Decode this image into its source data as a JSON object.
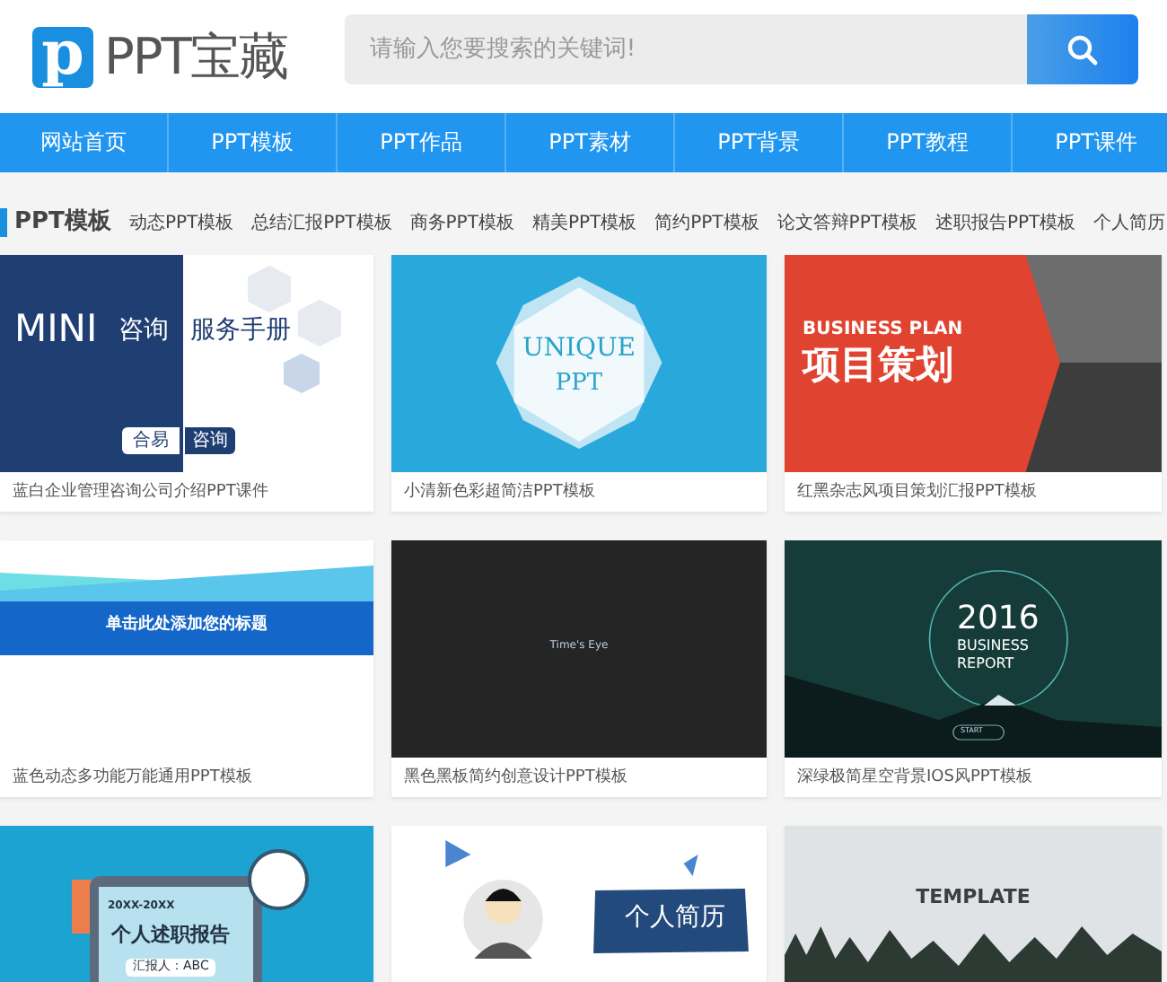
{
  "header": {
    "logo_letter": "p",
    "logo_text": "PPT宝藏",
    "search": {
      "placeholder": "请输入您要搜索的关键词!"
    }
  },
  "nav": [
    {
      "label": "网站首页",
      "selected": false
    },
    {
      "label": "PPT模板",
      "selected": false
    },
    {
      "label": "PPT作品",
      "selected": false
    },
    {
      "label": "PPT素材",
      "selected": false
    },
    {
      "label": "PPT背景",
      "selected": false
    },
    {
      "label": "PPT教程",
      "selected": false
    },
    {
      "label": "PPT课件",
      "selected": false
    }
  ],
  "category": {
    "title": "PPT模板",
    "links": [
      "动态PPT模板",
      "总结汇报PPT模板",
      "商务PPT模板",
      "精美PPT模板",
      "简约PPT模板",
      "论文答辩PPT模板",
      "述职报告PPT模板",
      "个人简历"
    ]
  },
  "cards": [
    {
      "kind": "consulting",
      "texts": [
        "MINI",
        "咨询",
        "服务手册",
        "合易",
        "咨询"
      ],
      "caption": "蓝白企业管理咨询公司介绍PPT课件"
    },
    {
      "kind": "unique",
      "texts": [
        "UNIQUE",
        "PPT"
      ],
      "caption": "小清新色彩超简洁PPT模板"
    },
    {
      "kind": "business-plan",
      "texts": [
        "BUSINESS PLAN",
        "项目策划"
      ],
      "caption": "红黑杂志风项目策划汇报PPT模板"
    },
    {
      "kind": "banner",
      "texts": [
        "单击此处添加您的标题"
      ],
      "caption": "蓝色动态多功能万能通用PPT模板"
    },
    {
      "kind": "dark",
      "texts": [
        "Time's Eye"
      ],
      "caption": "黑色黑板简约创意设计PPT模板"
    },
    {
      "kind": "report",
      "texts": [
        "2016",
        "BUSINESS",
        "REPORT",
        "START"
      ],
      "caption": "深绿极简星空背景IOS风PPT模板"
    },
    {
      "kind": "work-report",
      "texts": [
        "20XX-20XX",
        "个人述职报告",
        "汇报人：ABC"
      ]
    },
    {
      "kind": "resume",
      "texts": [
        "个人简历"
      ]
    },
    {
      "kind": "template",
      "texts": [
        "TEMPLATE"
      ]
    }
  ]
}
